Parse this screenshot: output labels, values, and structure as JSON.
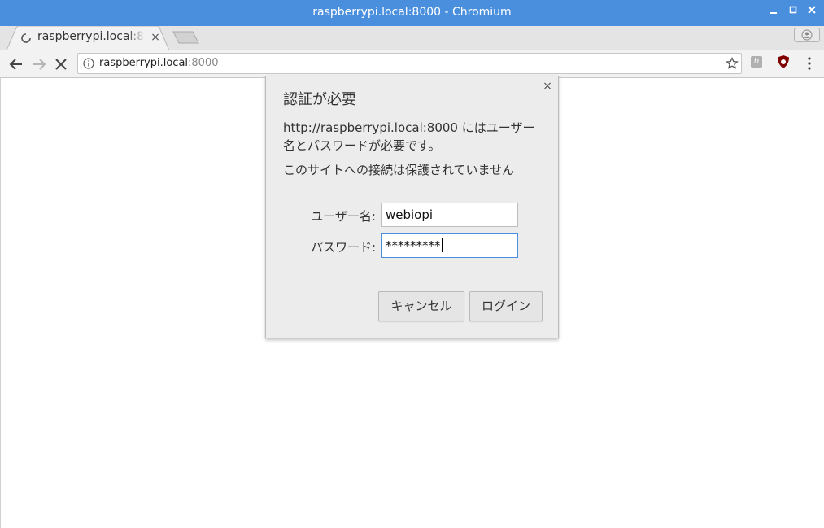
{
  "window": {
    "title": "raspberrypi.local:8000 - Chromium",
    "minimize_icon": "minimize-icon",
    "maximize_icon": "maximize-icon",
    "close_icon": "close-icon"
  },
  "tabs": [
    {
      "title": "raspberrypi.local:8",
      "loading": true,
      "close_label": "×"
    }
  ],
  "toolbar": {
    "url_host": "raspberrypi.local",
    "url_port": ":8000"
  },
  "dialog": {
    "title": "認証が必要",
    "message": "http://raspberrypi.local:8000 にはユーザー名とパスワードが必要です。",
    "warning": "このサイトへの接続は保護されていません",
    "username_label": "ユーザー名:",
    "username_value": "webiopi",
    "password_label": "パスワード:",
    "password_value": "*********",
    "cancel_label": "キャンセル",
    "login_label": "ログイン",
    "close_label": "×"
  },
  "colors": {
    "titlebar": "#4a8fdd",
    "focus_border": "#4a8fdd",
    "ublock_red": "#800000"
  }
}
